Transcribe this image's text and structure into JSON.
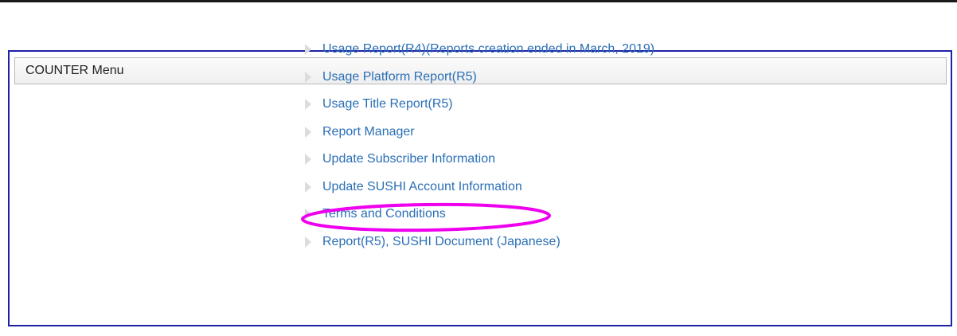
{
  "panel": {
    "title": "COUNTER Menu"
  },
  "menu": {
    "items": [
      {
        "label": "Usage Report(R4)(Reports creation ended in March, 2019)"
      },
      {
        "label": "Usage Platform Report(R5)"
      },
      {
        "label": "Usage Title Report(R5)"
      },
      {
        "label": "Report Manager"
      },
      {
        "label": "Update Subscriber Information",
        "highlighted": true
      },
      {
        "label": "Update SUSHI Account Information"
      },
      {
        "label": "Terms and Conditions"
      },
      {
        "label": "Report(R5), SUSHI Document (Japanese)"
      }
    ]
  },
  "colors": {
    "panel_border": "#1f20a8",
    "link": "#2a6fb5",
    "highlight": "#ee00ee"
  },
  "icons": {
    "menu_bullet": "triangle-right-icon"
  }
}
